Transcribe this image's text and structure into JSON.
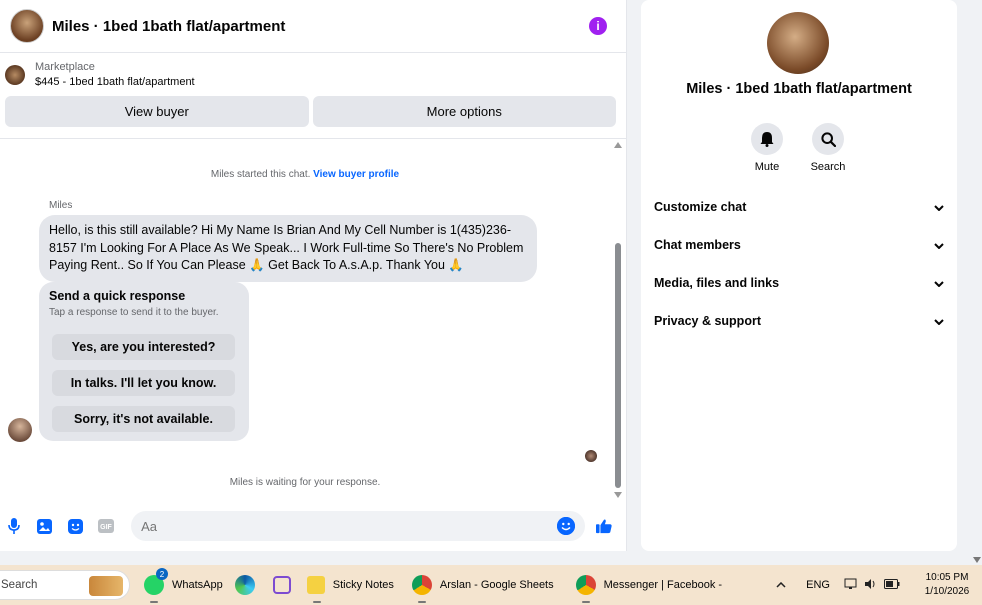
{
  "header": {
    "title": "Miles · 1bed 1bath flat/apartment",
    "info_icon": "i"
  },
  "listing": {
    "source": "Marketplace",
    "price_title": "$445 - 1bed 1bath flat/apartment"
  },
  "buttons": {
    "view_buyer": "View buyer",
    "more_options": "More options"
  },
  "messages": {
    "started": "Miles started this chat.",
    "view_profile": "View buyer profile",
    "sender": "Miles",
    "text": "Hello, is this still available? Hi My Name Is Brian And My Cell Number is 1(435)236-8157 I'm Looking For A Place As We Speak... I Work Full-time So There's No Problem Paying Rent.. So If You Can Please 🙏 Get Back To A.s.A.p. Thank You 🙏",
    "waiting": "Miles is waiting for your response."
  },
  "quick_response": {
    "title": "Send a quick response",
    "subtitle": "Tap a response to send it to the buyer.",
    "options": [
      "Yes, are you interested?",
      "In talks. I'll let you know.",
      "Sorry, it's not available."
    ]
  },
  "composer": {
    "placeholder": "Aa",
    "icons": [
      "microphone-icon",
      "image-icon",
      "sticker-icon",
      "gif-icon",
      "emoji-icon",
      "thumbs-up-icon"
    ],
    "gif_label": "GIF"
  },
  "side": {
    "title": "Miles · 1bed 1bath flat/apartment",
    "mute": "Mute",
    "search": "Search",
    "sections": [
      "Customize chat",
      "Chat members",
      "Media, files and links",
      "Privacy & support"
    ]
  },
  "taskbar": {
    "search": "Search",
    "whatsapp": "WhatsApp",
    "whatsapp_badge": "2",
    "sticky": "Sticky Notes",
    "sheets": "Arslan - Google Sheets",
    "messenger": "Messenger | Facebook -",
    "lang": "ENG",
    "time": "10:05 PM",
    "date": "1/10/2026"
  },
  "colors": {
    "accent": "#0866ff",
    "info": "#a020f0",
    "bubble": "#e4e6eb",
    "taskbar": "#f4e4cf"
  }
}
